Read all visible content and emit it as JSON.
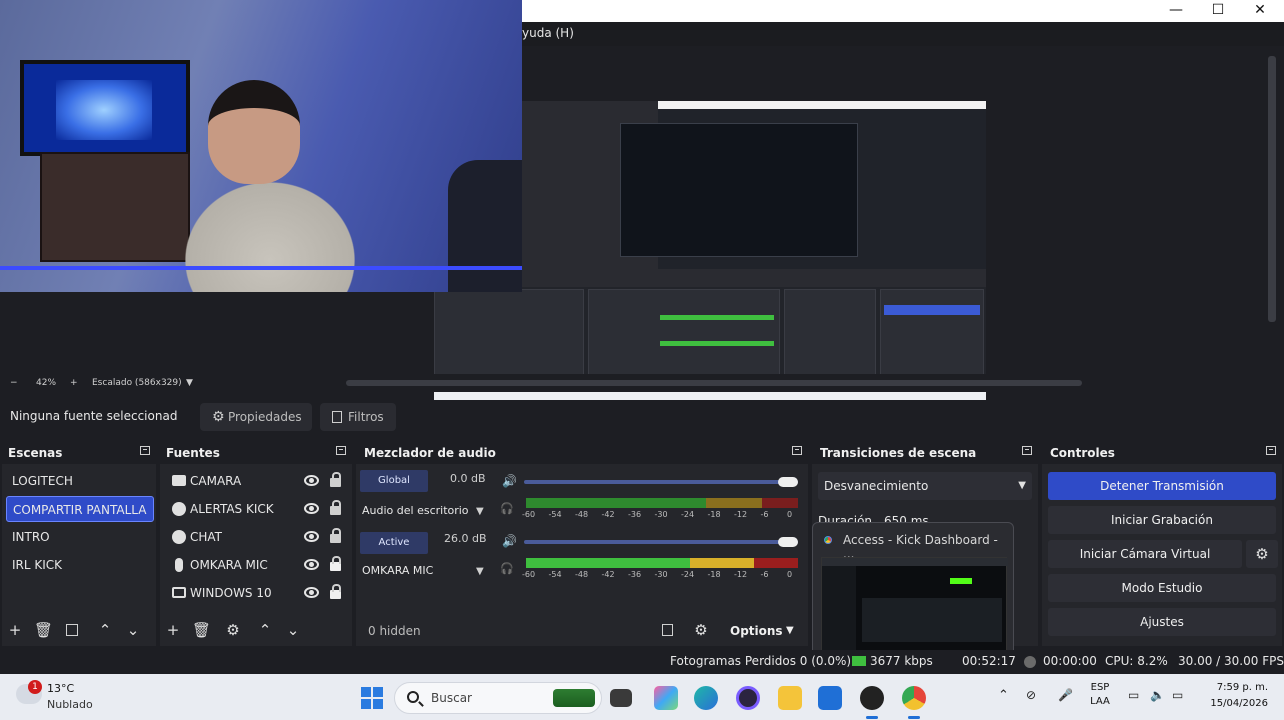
{
  "window": {
    "controls": [
      "—",
      "☐",
      "✕"
    ]
  },
  "menu": {
    "visible_item": "yuda (H)"
  },
  "preview": {
    "zoom_minus": "−",
    "zoom": "42%",
    "zoom_plus": "+",
    "scale": "Escalado (586x329)",
    "scale_caret": "▼"
  },
  "toast": {
    "title": "Access - Kick Dashboard - ..."
  },
  "source_bar": {
    "no_selection": "Ninguna fuente seleccionad",
    "properties": "Propiedades",
    "filters": "Filtros"
  },
  "scenes": {
    "title": "Escenas",
    "items": [
      "LOGITECH",
      "COMPARTIR PANTALLA",
      "INTRO",
      "IRL KICK"
    ],
    "active_index": 1
  },
  "sources": {
    "title": "Fuentes",
    "items": [
      {
        "label": "CAMARA",
        "icon": "camera-icon"
      },
      {
        "label": "ALERTAS KICK",
        "icon": "globe-icon"
      },
      {
        "label": "CHAT",
        "icon": "globe-icon"
      },
      {
        "label": "OMKARA MIC",
        "icon": "microphone-icon"
      },
      {
        "label": "WINDOWS 10",
        "icon": "monitor-icon"
      }
    ]
  },
  "mixer": {
    "title": "Mezclador de audio",
    "channels": [
      {
        "chip": "Global",
        "db": "0.0 dB",
        "name": "Audio del escritorio",
        "level": 0.86
      },
      {
        "chip": "Active",
        "db": "26.0 dB",
        "name": "OMKARA MIC",
        "level": 0.86
      }
    ],
    "ticks": [
      "-60",
      "-54",
      "-48",
      "-42",
      "-36",
      "-30",
      "-24",
      "-18",
      "-12",
      "-6",
      "0"
    ],
    "hidden": "0 hidden",
    "options": "Options",
    "options_caret": "▼"
  },
  "transitions": {
    "title": "Transiciones de escena",
    "selected": "Desvanecimiento",
    "caret": "▼",
    "duration_label": "Duración",
    "duration_value": "650 ms"
  },
  "controls": {
    "title": "Controles",
    "stop_stream": "Detener Transmisión",
    "start_recording": "Iniciar Grabación",
    "virtual_camera": "Iniciar Cámara Virtual",
    "studio_mode": "Modo Estudio",
    "settings": "Ajustes"
  },
  "status": {
    "dropped": "Fotogramas Perdidos 0 (0.0%)",
    "bitrate": "3677 kbps",
    "stream_time": "00:52:17",
    "rec_time": "00:00:00",
    "cpu": "CPU: 8.2%",
    "fps": "30.00 / 30.00 FPS"
  },
  "taskbar": {
    "weather_badge": "1",
    "temperature": "13°C",
    "condition": "Nublado",
    "search_placeholder": "Buscar",
    "lang_top": "ESP",
    "lang_bottom": "LAA",
    "time": "7:59 p. m.",
    "date": "15/04/2026"
  },
  "colors": {
    "accent_blue": "#2f4bc8",
    "meter_green": "#3fbf3f",
    "meter_yellow": "#d8b02a",
    "meter_red": "#c02a2a"
  }
}
